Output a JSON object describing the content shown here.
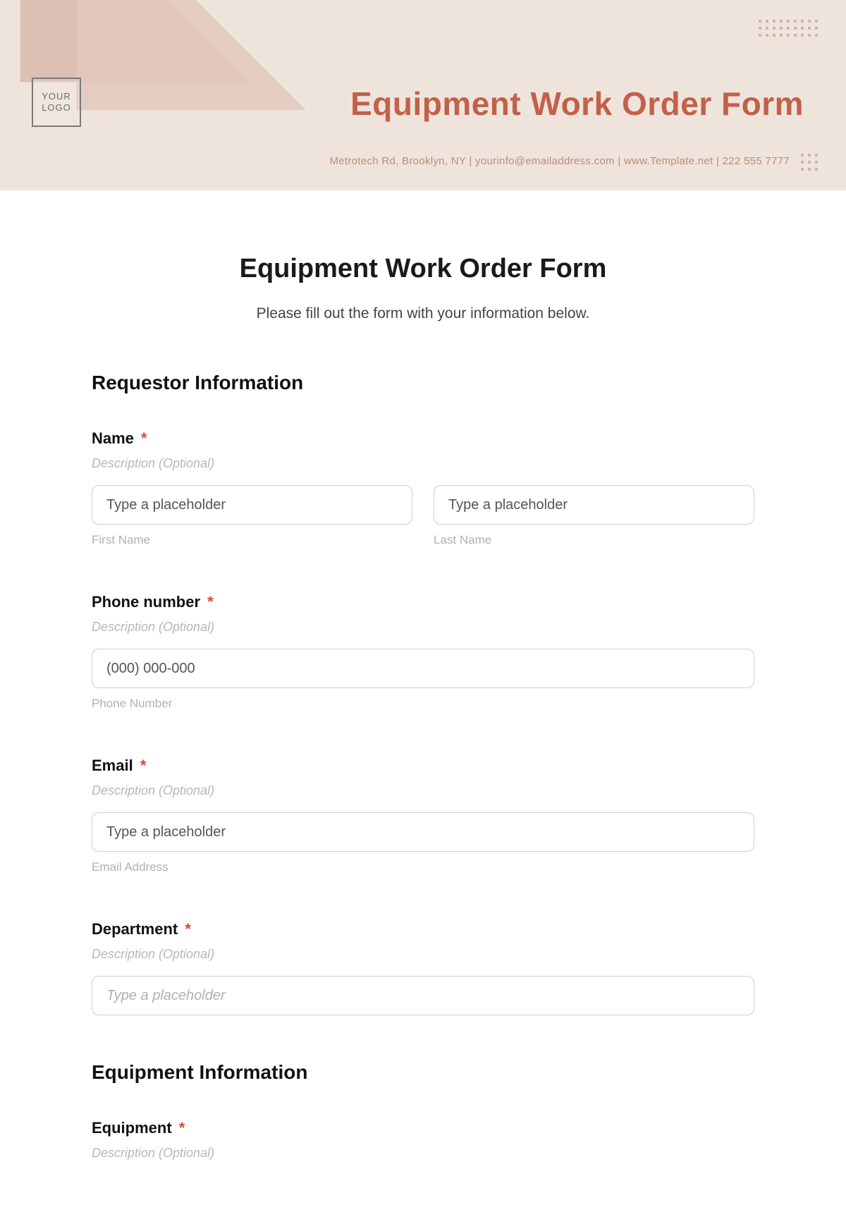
{
  "banner": {
    "logo_text": "YOUR LOGO",
    "title": "Equipment Work Order Form",
    "contact_line": "Metrotech Rd, Brooklyn, NY  |  yourinfo@emailaddress.com  |  www.Template.net  |  222 555 7777"
  },
  "page": {
    "title": "Equipment Work Order Form",
    "subtitle": "Please fill out the form with your information below."
  },
  "sections": {
    "requestor": {
      "heading": "Requestor Information",
      "name": {
        "label": "Name",
        "required": "*",
        "description": "Description (Optional)",
        "first_placeholder": "Type a placeholder",
        "first_sub": "First Name",
        "last_placeholder": "Type a placeholder",
        "last_sub": "Last Name"
      },
      "phone": {
        "label": "Phone number",
        "required": "*",
        "description": "Description (Optional)",
        "placeholder": "(000) 000-000",
        "sub": "Phone Number"
      },
      "email": {
        "label": "Email",
        "required": "*",
        "description": "Description (Optional)",
        "placeholder": "Type a placeholder",
        "sub": "Email Address"
      },
      "department": {
        "label": "Department",
        "required": "*",
        "description": "Description (Optional)",
        "placeholder": "Type a placeholder"
      }
    },
    "equipment": {
      "heading": "Equipment Information",
      "equipment_field": {
        "label": "Equipment",
        "required": "*",
        "description": "Description (Optional)"
      }
    }
  }
}
